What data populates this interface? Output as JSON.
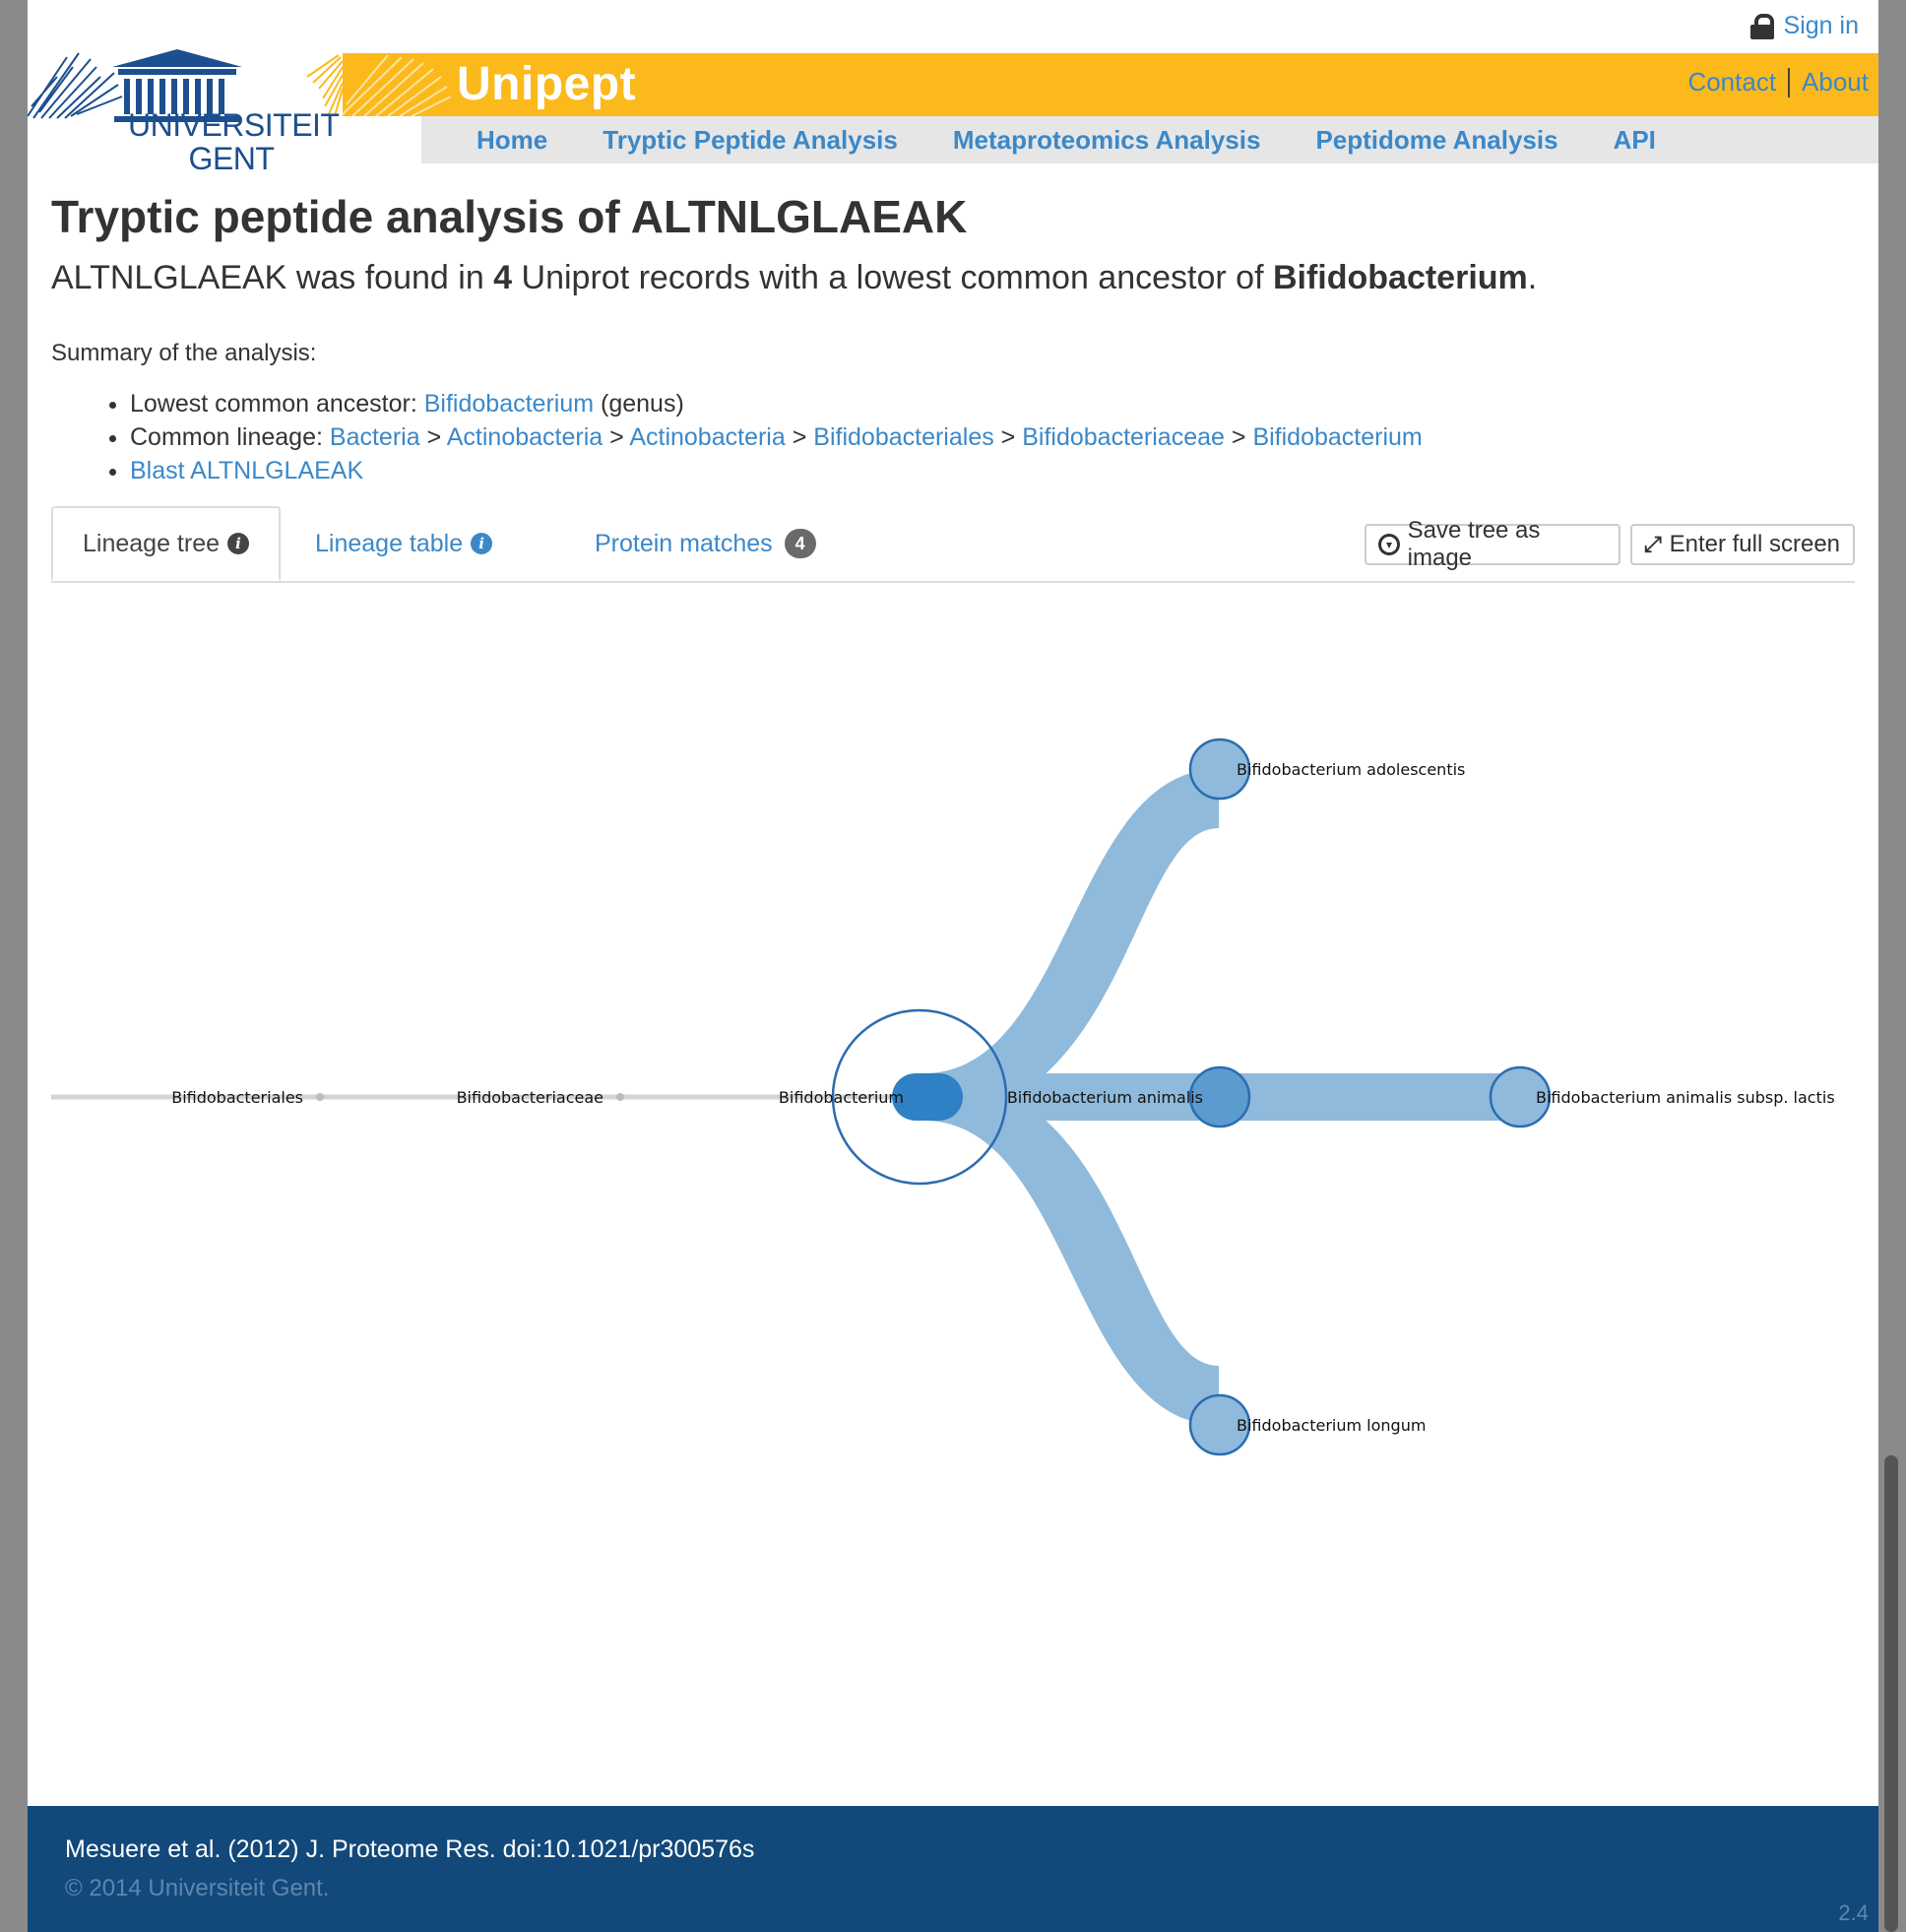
{
  "header": {
    "sign_in": "Sign in",
    "university_line1": "UNIVERSITEIT",
    "university_line2": "GENT",
    "brand": "Unipept",
    "contact": "Contact",
    "about": "About"
  },
  "nav": [
    "Home",
    "Tryptic Peptide Analysis",
    "Metaproteomics Analysis",
    "Peptidome Analysis",
    "API"
  ],
  "main": {
    "title": "Tryptic peptide analysis of ALTNLGLAEAK",
    "lead_peptide": "ALTNLGLAEAK",
    "lead_found": " was found in ",
    "lead_count": "4",
    "lead_middle": " Uniprot records with a lowest common ancestor of ",
    "lead_lca": "Bifidobacterium",
    "lead_end": ".",
    "summary_label": "Summary of the analysis:",
    "lca_label": "Lowest common ancestor: ",
    "lca_link": "Bifidobacterium",
    "lca_rank": " (genus)",
    "lineage_label": "Common lineage: ",
    "lineage": [
      "Bacteria",
      "Actinobacteria",
      "Actinobacteria",
      "Bifidobacteriales",
      "Bifidobacteriaceae",
      "Bifidobacterium"
    ],
    "lineage_sep": ">",
    "blast_link": "Blast ALTNLGLAEAK"
  },
  "tabs": {
    "lineage_tree": "Lineage tree",
    "lineage_table": "Lineage table",
    "protein_matches": "Protein matches",
    "protein_count": "4",
    "save_button": "Save tree as image",
    "fullscreen_button": "Enter full screen"
  },
  "tree": {
    "nodes": {
      "order": "Bifidobacteriales",
      "family": "Bifidobacteriaceae",
      "genus": "Bifidobacterium",
      "adolescentis": "Bifidobacterium adolescentis",
      "animalis": "Bifidobacterium animalis",
      "lactis": "Bifidobacterium animalis subsp. lactis",
      "longum": "Bifidobacterium longum"
    },
    "colors": {
      "link": "#8fbadb",
      "node": "#5b9bd0",
      "stroke": "#2b6cb0",
      "gray": "#d4d4d4"
    }
  },
  "footer": {
    "citation": "Mesuere et al. (2012) J. Proteome Res. doi:10.1021/pr300576s",
    "copyright": "© 2014 Universiteit Gent.",
    "version": "2.4"
  }
}
